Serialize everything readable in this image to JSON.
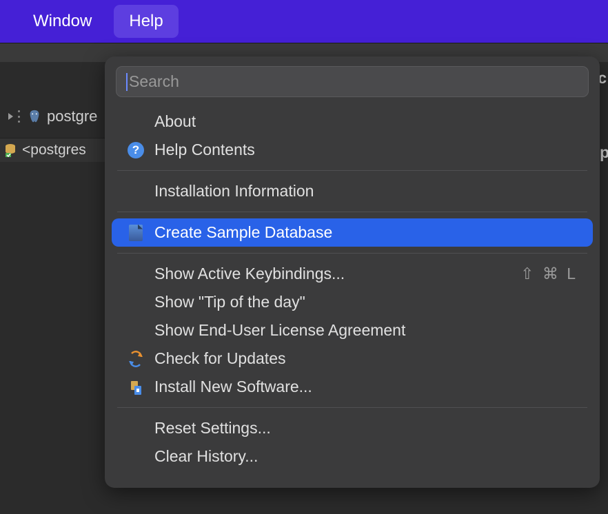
{
  "menubar": {
    "items": [
      {
        "label": "Window",
        "active": false
      },
      {
        "label": "Help",
        "active": true
      }
    ]
  },
  "sidebar": {
    "tree_item": "postgre",
    "tab_item": "<postgres"
  },
  "right_edge": {
    "top": "c",
    "mid": "p"
  },
  "dropdown": {
    "search_placeholder": "Search",
    "sections": [
      {
        "items": [
          {
            "label": "About",
            "icon": null
          },
          {
            "label": "Help Contents",
            "icon": "help"
          }
        ]
      },
      {
        "items": [
          {
            "label": "Installation Information",
            "icon": null
          }
        ]
      },
      {
        "items": [
          {
            "label": "Create Sample Database",
            "icon": "doc",
            "highlighted": true
          }
        ]
      },
      {
        "items": [
          {
            "label": "Show Active Keybindings...",
            "icon": null,
            "shortcut": "⇧ ⌘ L"
          },
          {
            "label": "Show \"Tip of the day\"",
            "icon": null
          },
          {
            "label": "Show End-User License Agreement",
            "icon": null
          },
          {
            "label": "Check for Updates",
            "icon": "update"
          },
          {
            "label": "Install New Software...",
            "icon": "install"
          }
        ]
      },
      {
        "items": [
          {
            "label": "Reset Settings...",
            "icon": null
          },
          {
            "label": "Clear History...",
            "icon": null
          }
        ]
      }
    ]
  }
}
